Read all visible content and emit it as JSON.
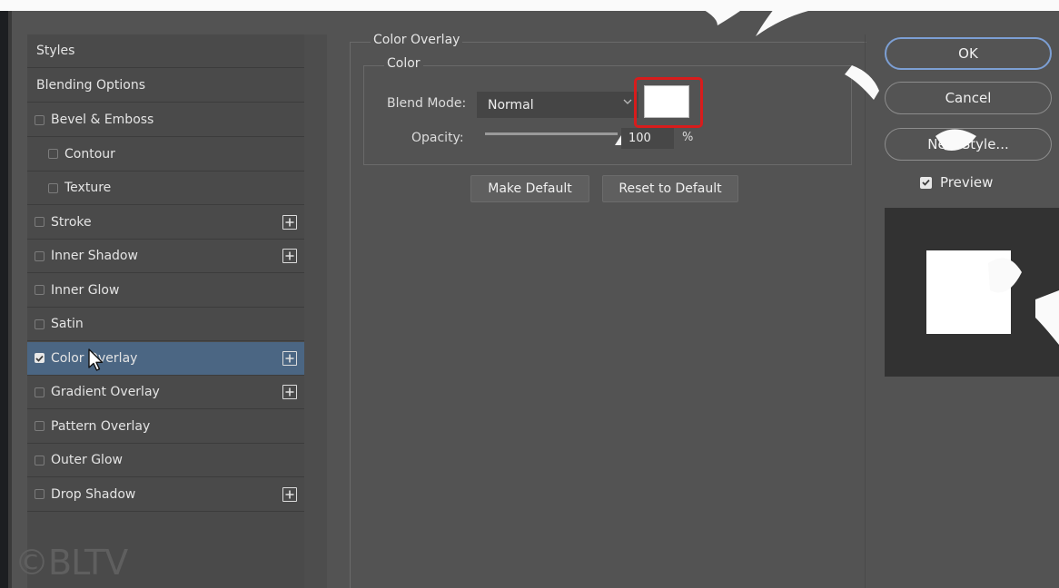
{
  "styles_panel": {
    "header": "Styles",
    "blending_options": "Blending Options",
    "items": [
      {
        "label": "Bevel & Emboss",
        "checked": false,
        "indent": false,
        "plus": false,
        "selected": false
      },
      {
        "label": "Contour",
        "checked": false,
        "indent": true,
        "plus": false,
        "selected": false
      },
      {
        "label": "Texture",
        "checked": false,
        "indent": true,
        "plus": false,
        "selected": false
      },
      {
        "label": "Stroke",
        "checked": false,
        "indent": false,
        "plus": true,
        "selected": false
      },
      {
        "label": "Inner Shadow",
        "checked": false,
        "indent": false,
        "plus": true,
        "selected": false
      },
      {
        "label": "Inner Glow",
        "checked": false,
        "indent": false,
        "plus": false,
        "selected": false
      },
      {
        "label": "Satin",
        "checked": false,
        "indent": false,
        "plus": false,
        "selected": false
      },
      {
        "label": "Color Overlay",
        "checked": true,
        "indent": false,
        "plus": true,
        "selected": true
      },
      {
        "label": "Gradient Overlay",
        "checked": false,
        "indent": false,
        "plus": true,
        "selected": false
      },
      {
        "label": "Pattern Overlay",
        "checked": false,
        "indent": false,
        "plus": false,
        "selected": false
      },
      {
        "label": "Outer Glow",
        "checked": false,
        "indent": false,
        "plus": false,
        "selected": false
      },
      {
        "label": "Drop Shadow",
        "checked": false,
        "indent": false,
        "plus": true,
        "selected": false
      }
    ]
  },
  "color_overlay": {
    "section_title": "Color Overlay",
    "group_title": "Color",
    "blend_mode_label": "Blend Mode:",
    "blend_mode_value": "Normal",
    "swatch_color": "#ffffff",
    "opacity_label": "Opacity:",
    "opacity_value": "100",
    "opacity_unit": "%",
    "make_default": "Make Default",
    "reset_default": "Reset to Default"
  },
  "actions": {
    "ok": "OK",
    "cancel": "Cancel",
    "new_style": "New Style...",
    "preview_label": "Preview",
    "preview_checked": true
  },
  "watermark": "©BLTV",
  "colors": {
    "panel_bg": "#535353",
    "selected_row": "#4b6683",
    "highlight_outline": "#d81c1c",
    "ok_border": "#7c9fd4"
  }
}
